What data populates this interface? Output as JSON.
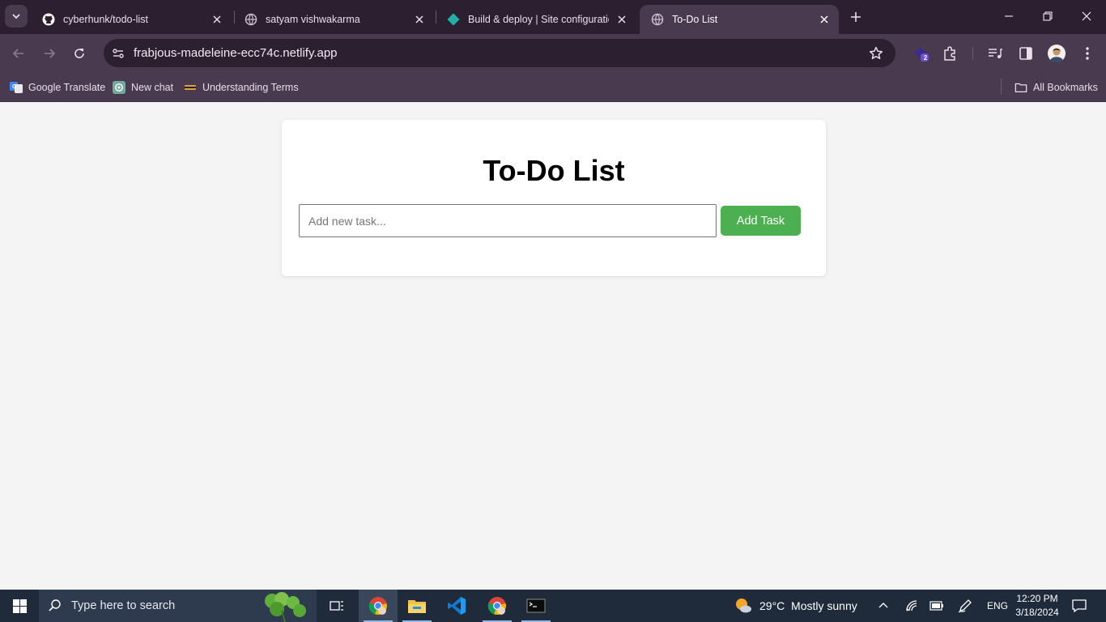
{
  "browser": {
    "tabs": [
      {
        "title": "cyberhunk/todo-list",
        "icon": "github-icon"
      },
      {
        "title": "satyam vishwakarma",
        "icon": "globe-icon"
      },
      {
        "title": "Build & deploy | Site configuration",
        "icon": "netlify-icon"
      },
      {
        "title": "To-Do List",
        "icon": "globe-icon",
        "active": true
      }
    ],
    "url": "frabjous-madeleine-ecc74c.netlify.app",
    "extension_badge": "2",
    "bookmarks": [
      {
        "label": "Google Translate",
        "icon": "google-translate-icon"
      },
      {
        "label": "New chat",
        "icon": "chatgpt-icon"
      },
      {
        "label": "Understanding Terms",
        "icon": "bookmark-favicon"
      }
    ],
    "all_bookmarks": "All Bookmarks"
  },
  "page": {
    "heading": "To-Do List",
    "input_placeholder": "Add new task...",
    "add_button": "Add Task",
    "accent_color": "#4caf50"
  },
  "taskbar": {
    "search_placeholder": "Type here to search",
    "weather": "29°C  Mostly sunny",
    "language": "ENG",
    "time": "12:20 PM",
    "date": "3/18/2024"
  }
}
